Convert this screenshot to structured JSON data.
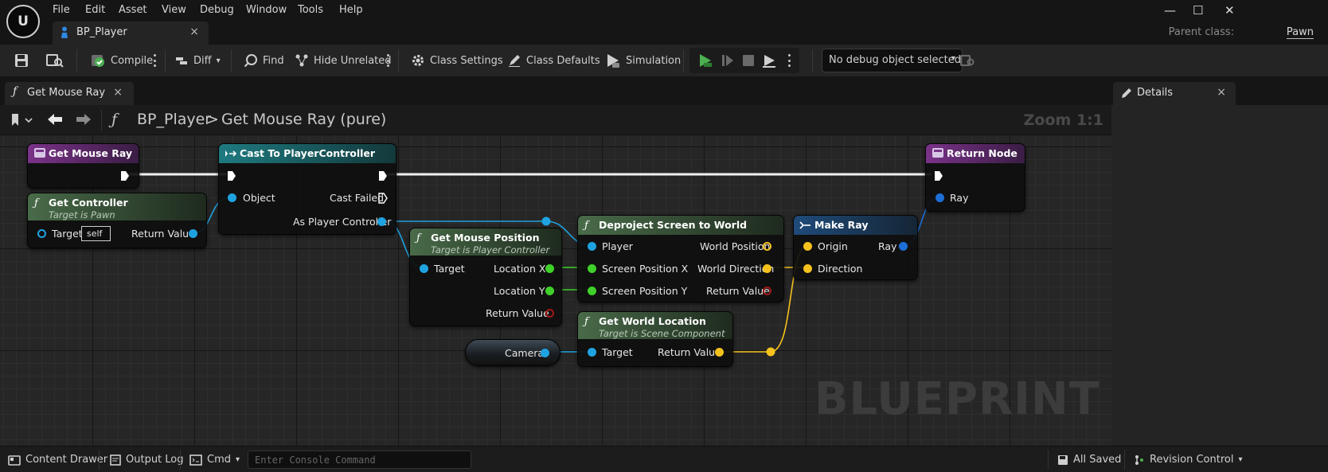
{
  "menu": {
    "logo": "U",
    "items": [
      "File",
      "Edit",
      "Asset",
      "View",
      "Debug",
      "Window",
      "Tools",
      "Help"
    ],
    "doc_tab": "BP_Player",
    "close": "×",
    "parent_class_label": "Parent class:",
    "parent_class_value": "Pawn",
    "window_controls": {
      "minimize": "—",
      "maximize": "☐",
      "close": "✕"
    }
  },
  "toolbar": {
    "compile": "Compile",
    "diff": "Diff",
    "find": "Find",
    "hide_unrelated": "Hide Unrelated",
    "class_settings": "Class Settings",
    "class_defaults": "Class Defaults",
    "simulation": "Simulation",
    "debug_object": "No debug object selected",
    "accent_green": "#4caf50"
  },
  "graph_tab": {
    "label": "Get Mouse Ray",
    "close": "×"
  },
  "breadcrumb": {
    "root": "BP_Player",
    "separator": ">",
    "current": "Get Mouse Ray (pure)",
    "zoom": "Zoom 1:1"
  },
  "watermark": "BLUEPRINT",
  "nodes": {
    "entry": {
      "title": "Get Mouse Ray"
    },
    "get_controller": {
      "title": "Get Controller",
      "subtitle": "Target is Pawn",
      "target_label": "Target",
      "target_default": "self",
      "return_label": "Return Value"
    },
    "cast": {
      "title": "Cast To PlayerController",
      "object_label": "Object",
      "cast_failed_label": "Cast Failed",
      "as_pc_label": "As Player Controller"
    },
    "mouse_pos": {
      "title": "Get Mouse Position",
      "subtitle": "Target is Player Controller",
      "target_label": "Target",
      "loc_x": "Location X",
      "loc_y": "Location Y",
      "return_label": "Return Value"
    },
    "deproject": {
      "title": "Deproject Screen to World",
      "player_label": "Player",
      "spx": "Screen Position X",
      "spy": "Screen Position Y",
      "world_pos": "World Position",
      "world_dir": "World Direction",
      "return_label": "Return Value"
    },
    "world_loc": {
      "title": "Get World Location",
      "subtitle": "Target is Scene Component",
      "target_label": "Target",
      "return_label": "Return Value"
    },
    "camera": {
      "label": "Camera"
    },
    "make_ray": {
      "title": "Make Ray",
      "origin": "Origin",
      "direction": "Direction",
      "ray": "Ray"
    },
    "return_node": {
      "title": "Return Node",
      "ray": "Ray"
    }
  },
  "details": {
    "title": "Details",
    "close": "×"
  },
  "statusbar": {
    "content_drawer": "Content Drawer",
    "output_log": "Output Log",
    "cmd": "Cmd",
    "console_placeholder": "Enter Console Command",
    "all_saved": "All Saved",
    "revision_control": "Revision Control"
  },
  "colors": {
    "pin_object": "#1fa3e0",
    "pin_float": "#3fd12a",
    "pin_vector": "#f5c21d",
    "pin_ray": "#1c6fd6",
    "pin_bool": "#8a0f0f",
    "header_pure": "#3f5a3f",
    "header_cast": "#1b6b70",
    "header_entry": "#6a2c7a"
  }
}
